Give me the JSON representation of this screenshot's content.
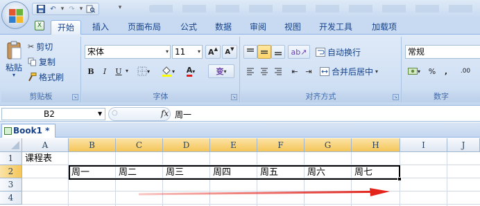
{
  "quick_access": {
    "icons": [
      "save-icon",
      "undo-icon",
      "redo-icon",
      "print-preview-icon",
      "customize-icon"
    ]
  },
  "tabs": [
    "开始",
    "插入",
    "页面布局",
    "公式",
    "数据",
    "审阅",
    "视图",
    "开发工具",
    "加载项"
  ],
  "ribbon": {
    "clipboard": {
      "paste": "粘贴",
      "cut": "剪切",
      "copy": "复制",
      "format_painter": "格式刷",
      "label": "剪贴板"
    },
    "font": {
      "name": "宋体",
      "size": "11",
      "grow": "A",
      "shrink": "A",
      "bold": "B",
      "italic": "I",
      "underline": "U",
      "font_color_letter": "A",
      "phonetic": "变",
      "label": "字体"
    },
    "alignment": {
      "wrap_text": "自动换行",
      "merge_center": "合并后居中",
      "label": "对齐方式"
    },
    "number": {
      "format": "常规",
      "percent": "%",
      "comma": ",",
      "increase_decimal": ".00",
      "label": "数字"
    }
  },
  "formula_bar": {
    "name_box": "B2",
    "fx": "fx",
    "content": "周一"
  },
  "workbook": {
    "tab": "Book1 *"
  },
  "sheet": {
    "columns": [
      "A",
      "B",
      "C",
      "D",
      "E",
      "F",
      "G",
      "H",
      "I",
      "J"
    ],
    "rows": [
      "1",
      "2",
      "3",
      "4"
    ],
    "cells": {
      "A1": "课程表",
      "B2": "周一",
      "C2": "周二",
      "D2": "周三",
      "E2": "周四",
      "F2": "周五",
      "G2": "周六",
      "H2": "周七"
    },
    "selection": "B2:H2"
  },
  "colors": {
    "ribbon_bg": "#dfeaf8",
    "selected_header": "#f5c659",
    "annotation_arrow": "#e3241b"
  }
}
